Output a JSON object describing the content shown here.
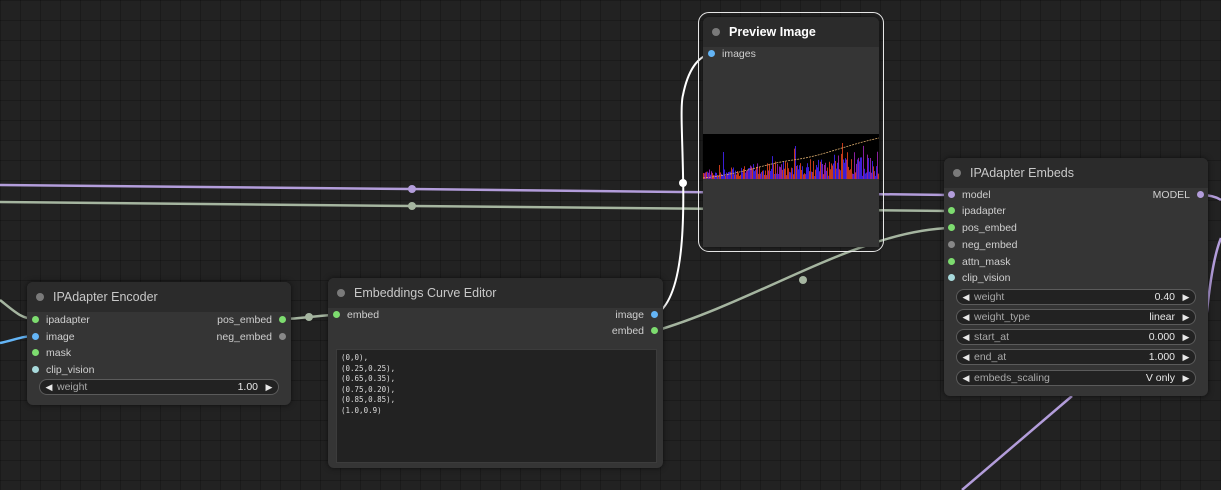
{
  "colors": {
    "canvas": "#222222",
    "node_body": "#353535",
    "node_title": "#2b2b2b",
    "model_link": "#b39ddb",
    "ipadapter_link": "#a5b5a0",
    "image_link": "#ffffff",
    "slot_image": "#64b5f6",
    "slot_green": "#7ddc6f",
    "slot_model": "#b39ddb",
    "slot_clip_vision": "#a8dadc",
    "slot_disconnected": "#888888"
  },
  "encoder": {
    "title": "IPAdapter Encoder",
    "inputs": [
      "ipadapter",
      "image",
      "mask",
      "clip_vision"
    ],
    "outputs": [
      "pos_embed",
      "neg_embed"
    ],
    "weight": {
      "name": "weight",
      "value": "1.00"
    }
  },
  "curve": {
    "title": "Embeddings Curve Editor",
    "inputs": [
      "embed"
    ],
    "outputs": [
      "image",
      "embed"
    ],
    "text_lines": [
      "(0,0),",
      "(0.25,0.25),",
      "(0.65,0.35),",
      "(0.75,0.20),",
      "(0.85,0.85),",
      "(1.0,0.9)"
    ]
  },
  "preview": {
    "title": "Preview Image",
    "inputs": [
      "images"
    ]
  },
  "embeds": {
    "title": "IPAdapter Embeds",
    "inputs": [
      "model",
      "ipadapter",
      "pos_embed",
      "neg_embed",
      "attn_mask",
      "clip_vision"
    ],
    "outputs": [
      "MODEL"
    ],
    "widgets": [
      {
        "name": "weight",
        "value": "0.40"
      },
      {
        "name": "weight_type",
        "value": "linear"
      },
      {
        "name": "start_at",
        "value": "0.000"
      },
      {
        "name": "end_at",
        "value": "1.000"
      },
      {
        "name": "embeds_scaling",
        "value": "V only"
      }
    ]
  }
}
